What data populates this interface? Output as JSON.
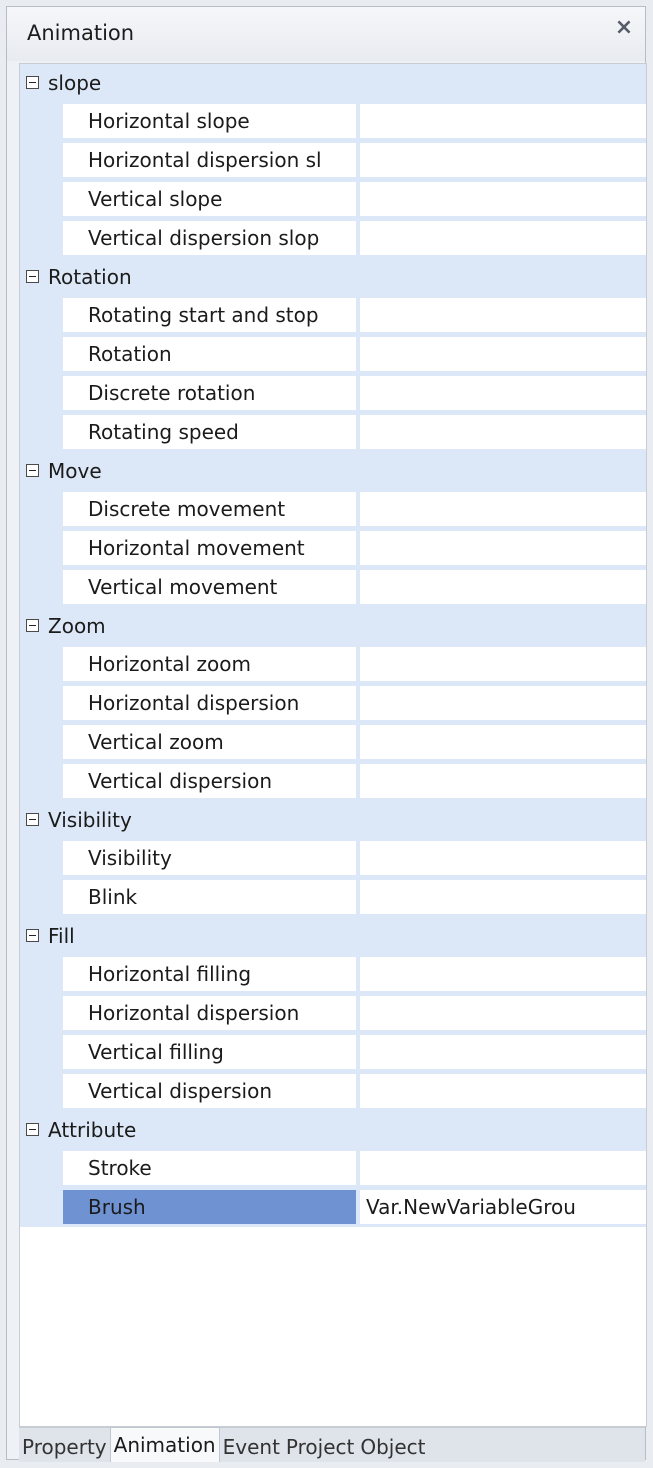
{
  "window": {
    "title": "Animation",
    "close_glyph": "×"
  },
  "categories": [
    {
      "label": "slope",
      "rows": [
        {
          "name": "Horizontal slope",
          "value": ""
        },
        {
          "name": "Horizontal dispersion sl",
          "value": ""
        },
        {
          "name": "Vertical slope",
          "value": ""
        },
        {
          "name": "Vertical dispersion slop",
          "value": ""
        }
      ]
    },
    {
      "label": "Rotation",
      "rows": [
        {
          "name": "Rotating start and stop",
          "value": ""
        },
        {
          "name": "Rotation",
          "value": ""
        },
        {
          "name": "Discrete rotation",
          "value": ""
        },
        {
          "name": "Rotating speed",
          "value": ""
        }
      ]
    },
    {
      "label": "Move",
      "rows": [
        {
          "name": "Discrete movement",
          "value": ""
        },
        {
          "name": "Horizontal movement",
          "value": ""
        },
        {
          "name": "Vertical movement",
          "value": ""
        }
      ]
    },
    {
      "label": "Zoom",
      "rows": [
        {
          "name": "Horizontal zoom",
          "value": ""
        },
        {
          "name": "Horizontal dispersion",
          "value": ""
        },
        {
          "name": "Vertical zoom",
          "value": ""
        },
        {
          "name": "Vertical dispersion",
          "value": ""
        }
      ]
    },
    {
      "label": "Visibility",
      "rows": [
        {
          "name": "Visibility",
          "value": ""
        },
        {
          "name": "Blink",
          "value": ""
        }
      ]
    },
    {
      "label": "Fill",
      "rows": [
        {
          "name": "Horizontal filling",
          "value": ""
        },
        {
          "name": "Horizontal dispersion",
          "value": ""
        },
        {
          "name": "Vertical filling",
          "value": ""
        },
        {
          "name": "Vertical dispersion",
          "value": ""
        }
      ]
    },
    {
      "label": "Attribute",
      "rows": [
        {
          "name": "Stroke",
          "value": ""
        },
        {
          "name": "Brush",
          "value": "Var.NewVariableGrou",
          "selected": true
        }
      ]
    }
  ],
  "tabs": [
    {
      "label": "Property",
      "active": false
    },
    {
      "label": "Animation",
      "active": true
    },
    {
      "label": "Event",
      "active": false
    },
    {
      "label": "Project",
      "active": false
    },
    {
      "label": "Object",
      "active": false
    }
  ],
  "colors": {
    "category_bg": "#dce8f7",
    "selected_name_bg": "#6f92d3"
  }
}
